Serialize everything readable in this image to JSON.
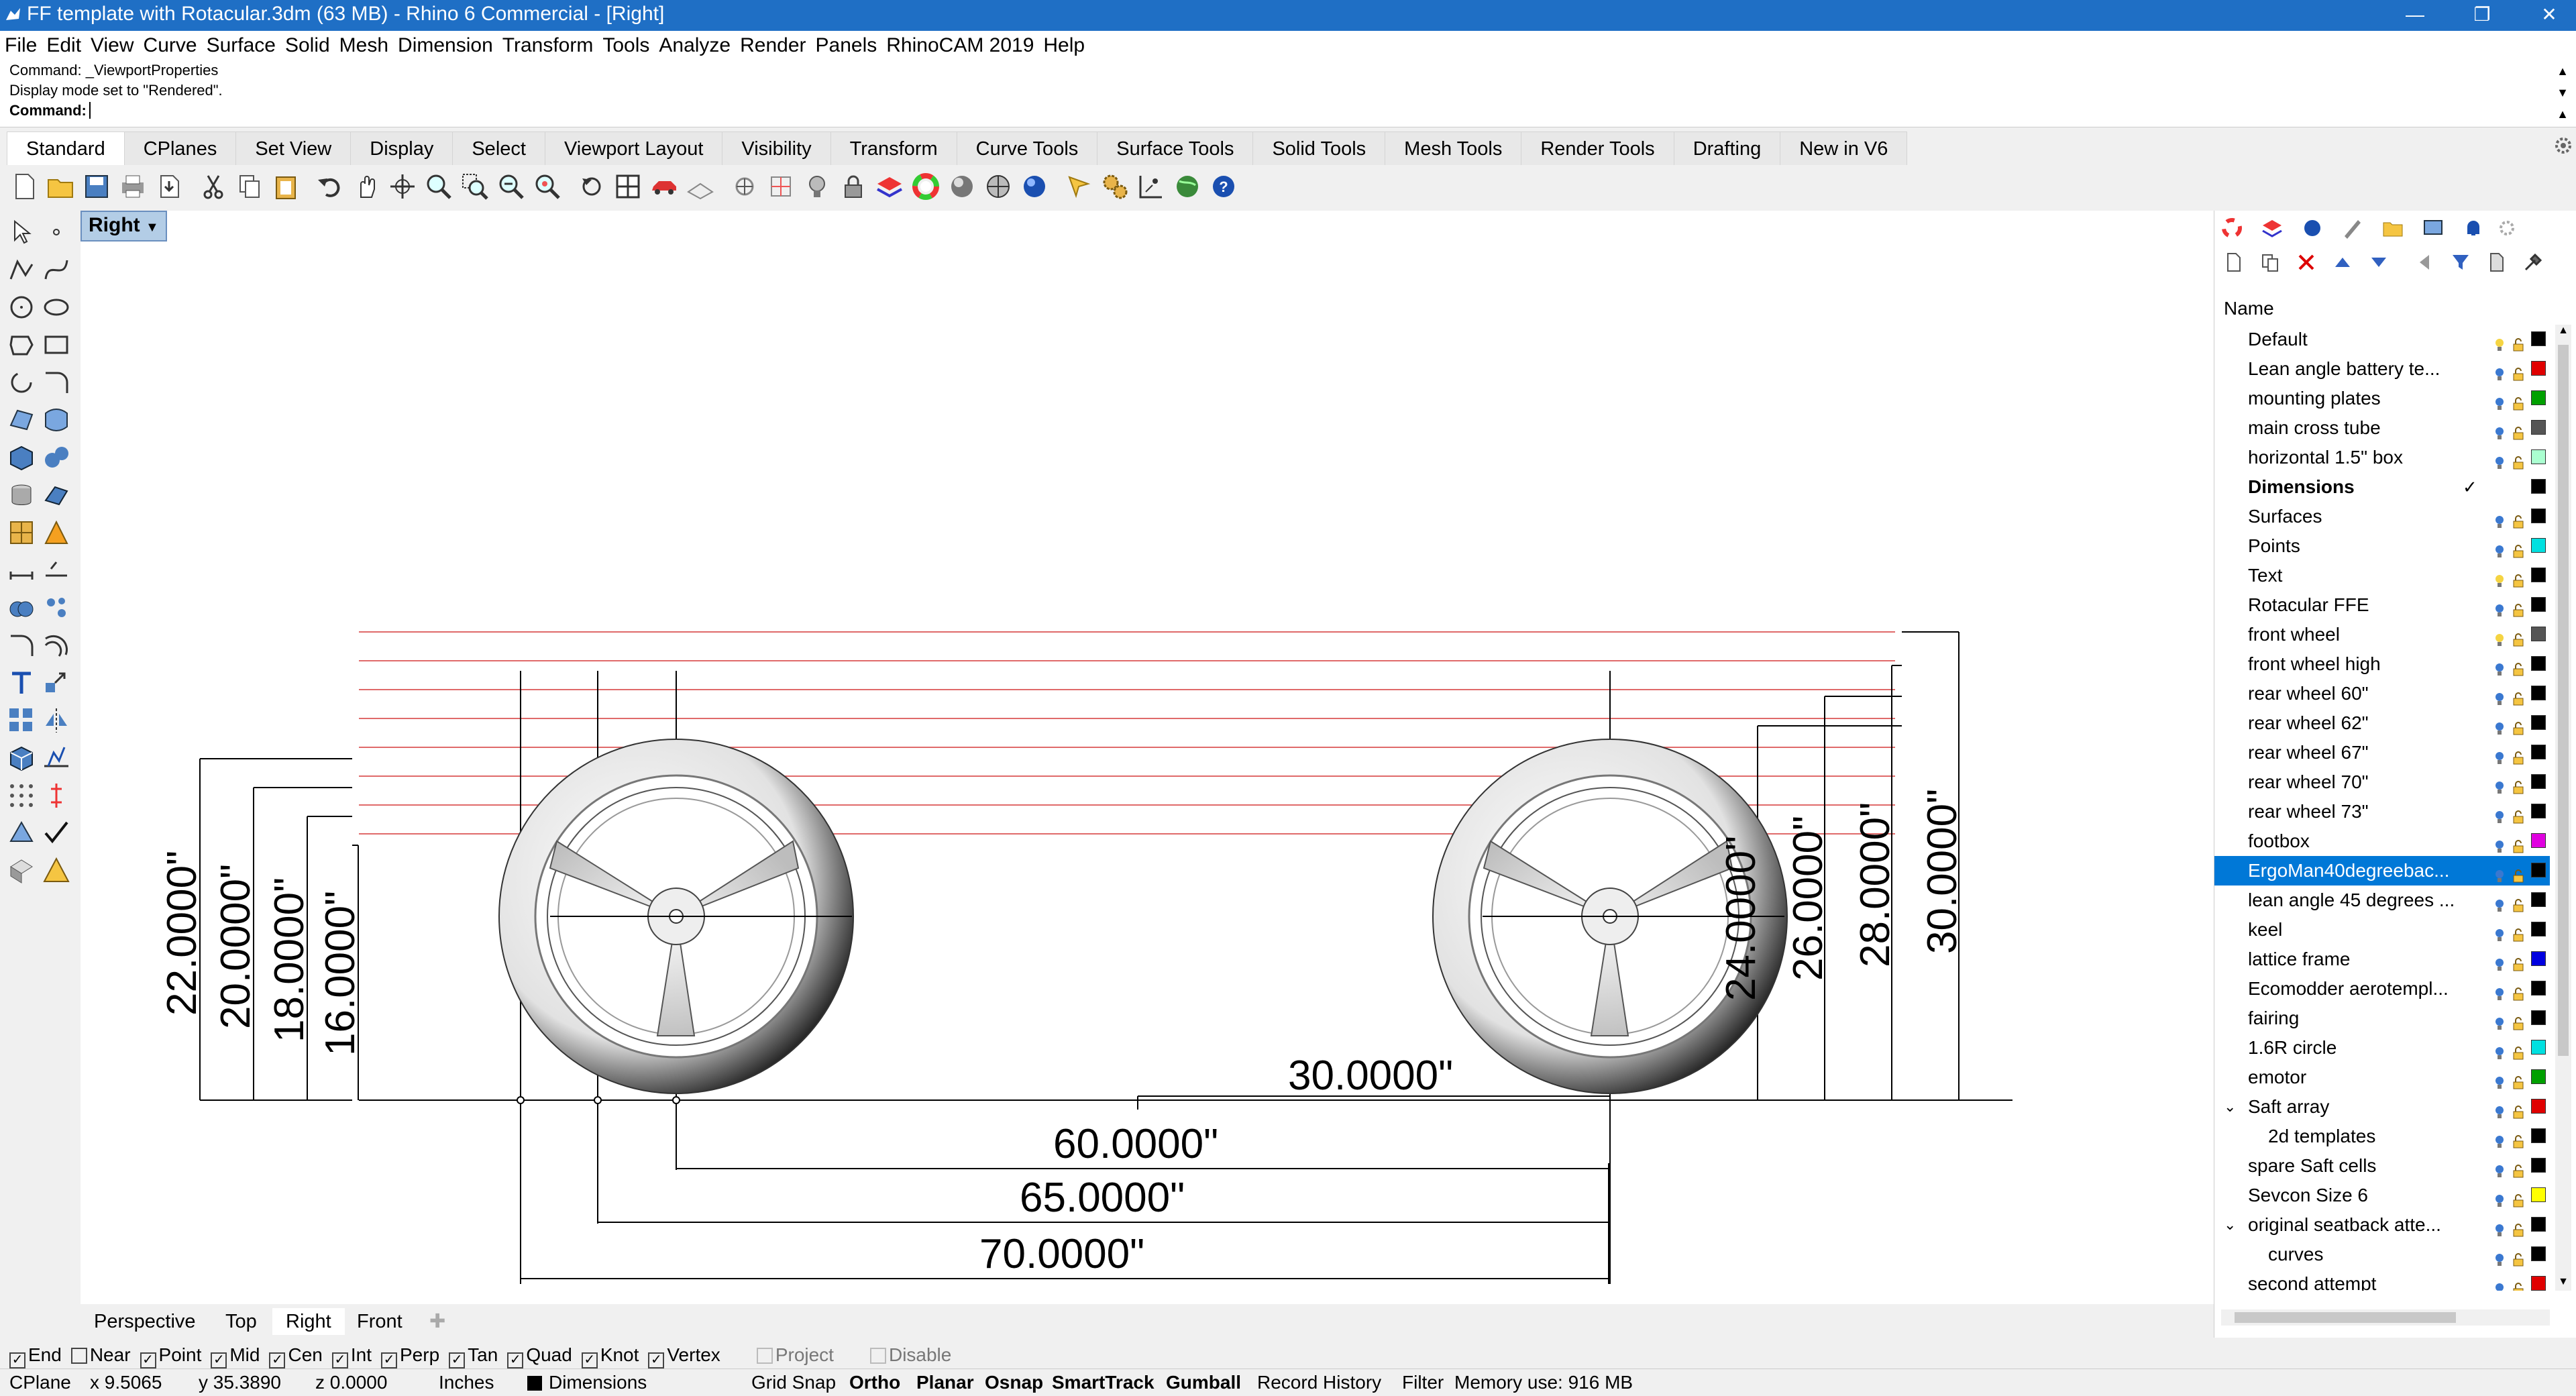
{
  "window": {
    "title": "FF template with Rotacular.3dm (63 MB) - Rhino 6 Commercial - [Right]"
  },
  "menubar": [
    "File",
    "Edit",
    "View",
    "Curve",
    "Surface",
    "Solid",
    "Mesh",
    "Dimension",
    "Transform",
    "Tools",
    "Analyze",
    "Render",
    "Panels",
    "RhinoCAM 2019",
    "Help"
  ],
  "command": {
    "line1": "Command: _ViewportProperties",
    "line2": "Display mode set to \"Rendered\".",
    "prompt": "Command:"
  },
  "tabs": [
    "Standard",
    "CPlanes",
    "Set View",
    "Display",
    "Select",
    "Viewport Layout",
    "Visibility",
    "Transform",
    "Curve Tools",
    "Surface Tools",
    "Solid Tools",
    "Mesh Tools",
    "Render Tools",
    "Drafting",
    "New in V6"
  ],
  "viewport": {
    "label": "Right",
    "dims": {
      "d22": "22.0000\"",
      "d20": "20.0000\"",
      "d18": "18.0000\"",
      "d16": "16.0000\"",
      "d24": "24.0000\"",
      "d26": "26.0000\"",
      "d28": "28.0000\"",
      "d30v": "30.0000\"",
      "d30h": "30.0000\"",
      "d60": "60.0000\"",
      "d65": "65.0000\"",
      "d70": "70.0000\""
    }
  },
  "viewport_tabs": [
    "Perspective",
    "Top",
    "Right",
    "Front"
  ],
  "layers_panel": {
    "header": "Name",
    "layers": [
      {
        "name": "Default",
        "color": "#000000"
      },
      {
        "name": "Lean angle battery te...",
        "color": "#e00000"
      },
      {
        "name": "mounting plates",
        "color": "#00a000"
      },
      {
        "name": "main cross tube",
        "color": "#555555"
      },
      {
        "name": "horizontal 1.5\" box",
        "color": "#aaffd0"
      },
      {
        "name": "Dimensions",
        "color": "#000000",
        "current": true
      },
      {
        "name": "Surfaces",
        "color": "#000000"
      },
      {
        "name": "Points",
        "color": "#00e0e0"
      },
      {
        "name": "Text",
        "color": "#000000"
      },
      {
        "name": "Rotacular FFE",
        "color": "#000000"
      },
      {
        "name": "front wheel",
        "color": "#555555"
      },
      {
        "name": "front wheel high",
        "color": "#000000"
      },
      {
        "name": "rear wheel 60\"",
        "color": "#000000"
      },
      {
        "name": "rear wheel 62\"",
        "color": "#000000"
      },
      {
        "name": "rear wheel 67\"",
        "color": "#000000"
      },
      {
        "name": "rear wheel 70\"",
        "color": "#000000"
      },
      {
        "name": "rear wheel 73\"",
        "color": "#000000"
      },
      {
        "name": "footbox",
        "color": "#e000e0"
      },
      {
        "name": "ErgoMan40degreebac...",
        "color": "#000000",
        "selected": true
      },
      {
        "name": "lean angle 45 degrees ...",
        "color": "#000000"
      },
      {
        "name": "keel",
        "color": "#000000"
      },
      {
        "name": "lattice frame",
        "color": "#0000e0"
      },
      {
        "name": "Ecomodder aerotempl...",
        "color": "#000000"
      },
      {
        "name": "fairing",
        "color": "#000000"
      },
      {
        "name": "1.6R circle",
        "color": "#00e0e0"
      },
      {
        "name": "emotor",
        "color": "#00a000"
      },
      {
        "name": "Saft array",
        "color": "#e00000"
      },
      {
        "name": "2d templates",
        "color": "#000000"
      },
      {
        "name": "spare Saft cells",
        "color": "#000000"
      },
      {
        "name": "Sevcon Size 6",
        "color": "#ffff00"
      },
      {
        "name": "original seatback atte...",
        "color": "#000000"
      },
      {
        "name": "curves",
        "color": "#000000"
      },
      {
        "name": "second attempt",
        "color": "#e00000"
      }
    ]
  },
  "osnap": [
    {
      "label": "End",
      "checked": true
    },
    {
      "label": "Near",
      "checked": false
    },
    {
      "label": "Point",
      "checked": true
    },
    {
      "label": "Mid",
      "checked": true
    },
    {
      "label": "Cen",
      "checked": true
    },
    {
      "label": "Int",
      "checked": true
    },
    {
      "label": "Perp",
      "checked": true
    },
    {
      "label": "Tan",
      "checked": true
    },
    {
      "label": "Quad",
      "checked": true
    },
    {
      "label": "Knot",
      "checked": true
    },
    {
      "label": "Vertex",
      "checked": true
    },
    {
      "label": "Project",
      "checked": false,
      "disabled": true
    },
    {
      "label": "Disable",
      "checked": false,
      "disabled": true
    }
  ],
  "status": {
    "cplane": "CPlane",
    "x": "x 9.5065",
    "y": "y 35.3890",
    "z": "z 0.0000",
    "units": "Inches",
    "layer": "Dimensions",
    "grid_snap": "Grid Snap",
    "ortho": "Ortho",
    "planar": "Planar",
    "osnap": "Osnap",
    "smarttrack": "SmartTrack",
    "gumball": "Gumball",
    "record_history": "Record History",
    "filter": "Filter",
    "memory": "Memory use: 916 MB"
  }
}
